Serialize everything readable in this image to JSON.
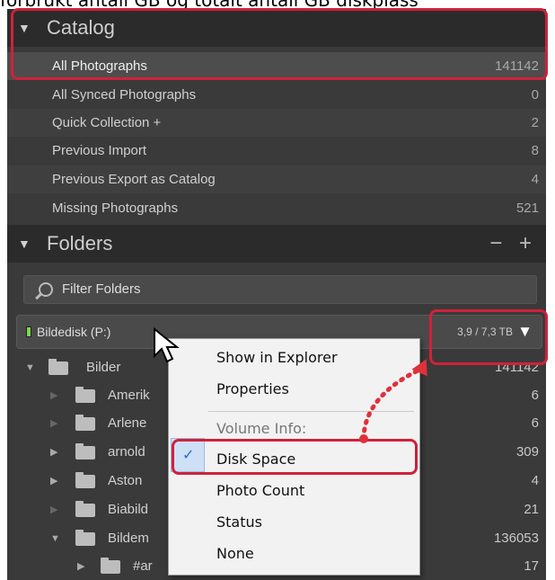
{
  "caption": "forbrukt antall GB og totalt antall GB diskplass",
  "catalog": {
    "title": "Catalog",
    "items": [
      {
        "label": "All Photographs",
        "count": "141142"
      },
      {
        "label": "All Synced Photographs",
        "count": "0"
      },
      {
        "label": "Quick Collection  +",
        "count": "2"
      },
      {
        "label": "Previous Import",
        "count": "8"
      },
      {
        "label": "Previous Export as Catalog",
        "count": "4"
      },
      {
        "label": "Missing Photographs",
        "count": "521"
      }
    ]
  },
  "folders": {
    "title": "Folders",
    "actions": "− +",
    "filter_label": "Filter Folders",
    "volume": {
      "name": "Bildedisk (P:)",
      "info": "3,9 / 7,3 TB"
    },
    "tree": [
      {
        "name": "Bilder",
        "count": "141142"
      },
      {
        "name": "Amerik",
        "count": "6"
      },
      {
        "name": "Arlene",
        "count": "6"
      },
      {
        "name": "arnold",
        "count": "309"
      },
      {
        "name": "Aston",
        "count": "4"
      },
      {
        "name": "Biabild",
        "count": "21"
      },
      {
        "name": "Bildem",
        "count": "136053"
      },
      {
        "name": "#ar",
        "count": "17"
      }
    ]
  },
  "context_menu": {
    "show_in_explorer": "Show in Explorer",
    "properties": "Properties",
    "volume_info": "Volume Info:",
    "disk_space": "Disk Space",
    "photo_count": "Photo Count",
    "status": "Status",
    "none": "None",
    "checked_item": "Disk Space"
  },
  "colors": {
    "highlight": "#d0213a",
    "accent": "#2d6bc4",
    "panel": "#3a3a3a"
  }
}
